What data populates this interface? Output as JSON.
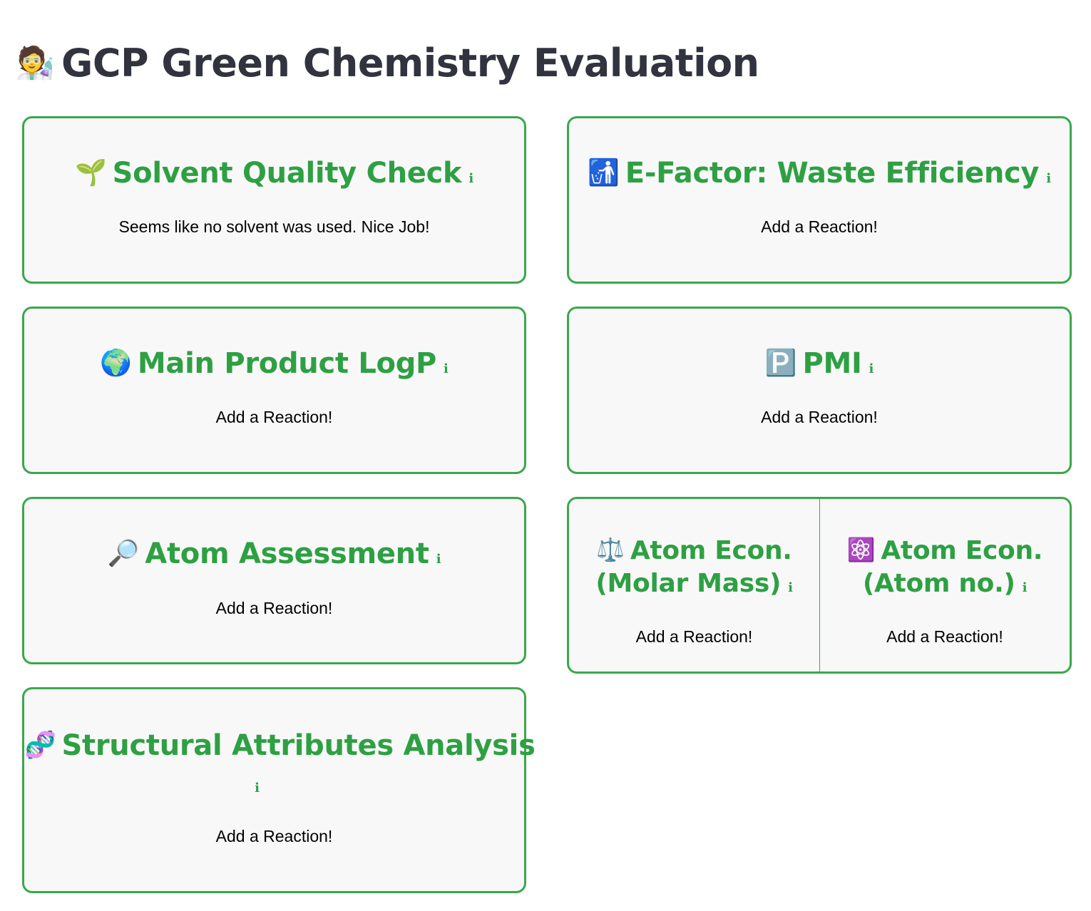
{
  "page": {
    "title": "GCP Green Chemistry Evaluation",
    "title_icon": "scientist-emoji"
  },
  "colors": {
    "accent": "#2ea043",
    "border": "#3aa84a",
    "card_bg": "#f8f8f8",
    "title_text": "#31333f"
  },
  "cards": {
    "solvent": {
      "icon": "seedling",
      "title": "Solvent Quality Check",
      "info": "i",
      "text": "Seems like no solvent was used. Nice Job!"
    },
    "efactor": {
      "icon": "waste-bin",
      "title": "E-Factor: Waste Efficiency",
      "info": "i",
      "text": "Add a Reaction!"
    },
    "logp": {
      "icon": "globe",
      "title": "Main Product LogP",
      "info": "i",
      "text": "Add a Reaction!"
    },
    "pmi": {
      "icon": "parking-p",
      "title": "PMI",
      "info": "i",
      "text": "Add a Reaction!"
    },
    "atom_assessment": {
      "icon": "magnifier",
      "title": "Atom Assessment",
      "info": "i",
      "text": "Add a Reaction!"
    },
    "atom_econ_mass": {
      "icon": "balance-scale",
      "title_line1": "Atom Econ.",
      "title_line2": "(Molar Mass)",
      "info": "i",
      "text": "Add a Reaction!"
    },
    "atom_econ_number": {
      "icon": "atom-symbol",
      "title_line1": "Atom Econ.",
      "title_line2": "(Atom no.)",
      "info": "i",
      "text": "Add a Reaction!"
    },
    "structural": {
      "icon": "dna",
      "title": "Structural Attributes Analysis",
      "info": "i",
      "text": "Add a Reaction!"
    }
  }
}
